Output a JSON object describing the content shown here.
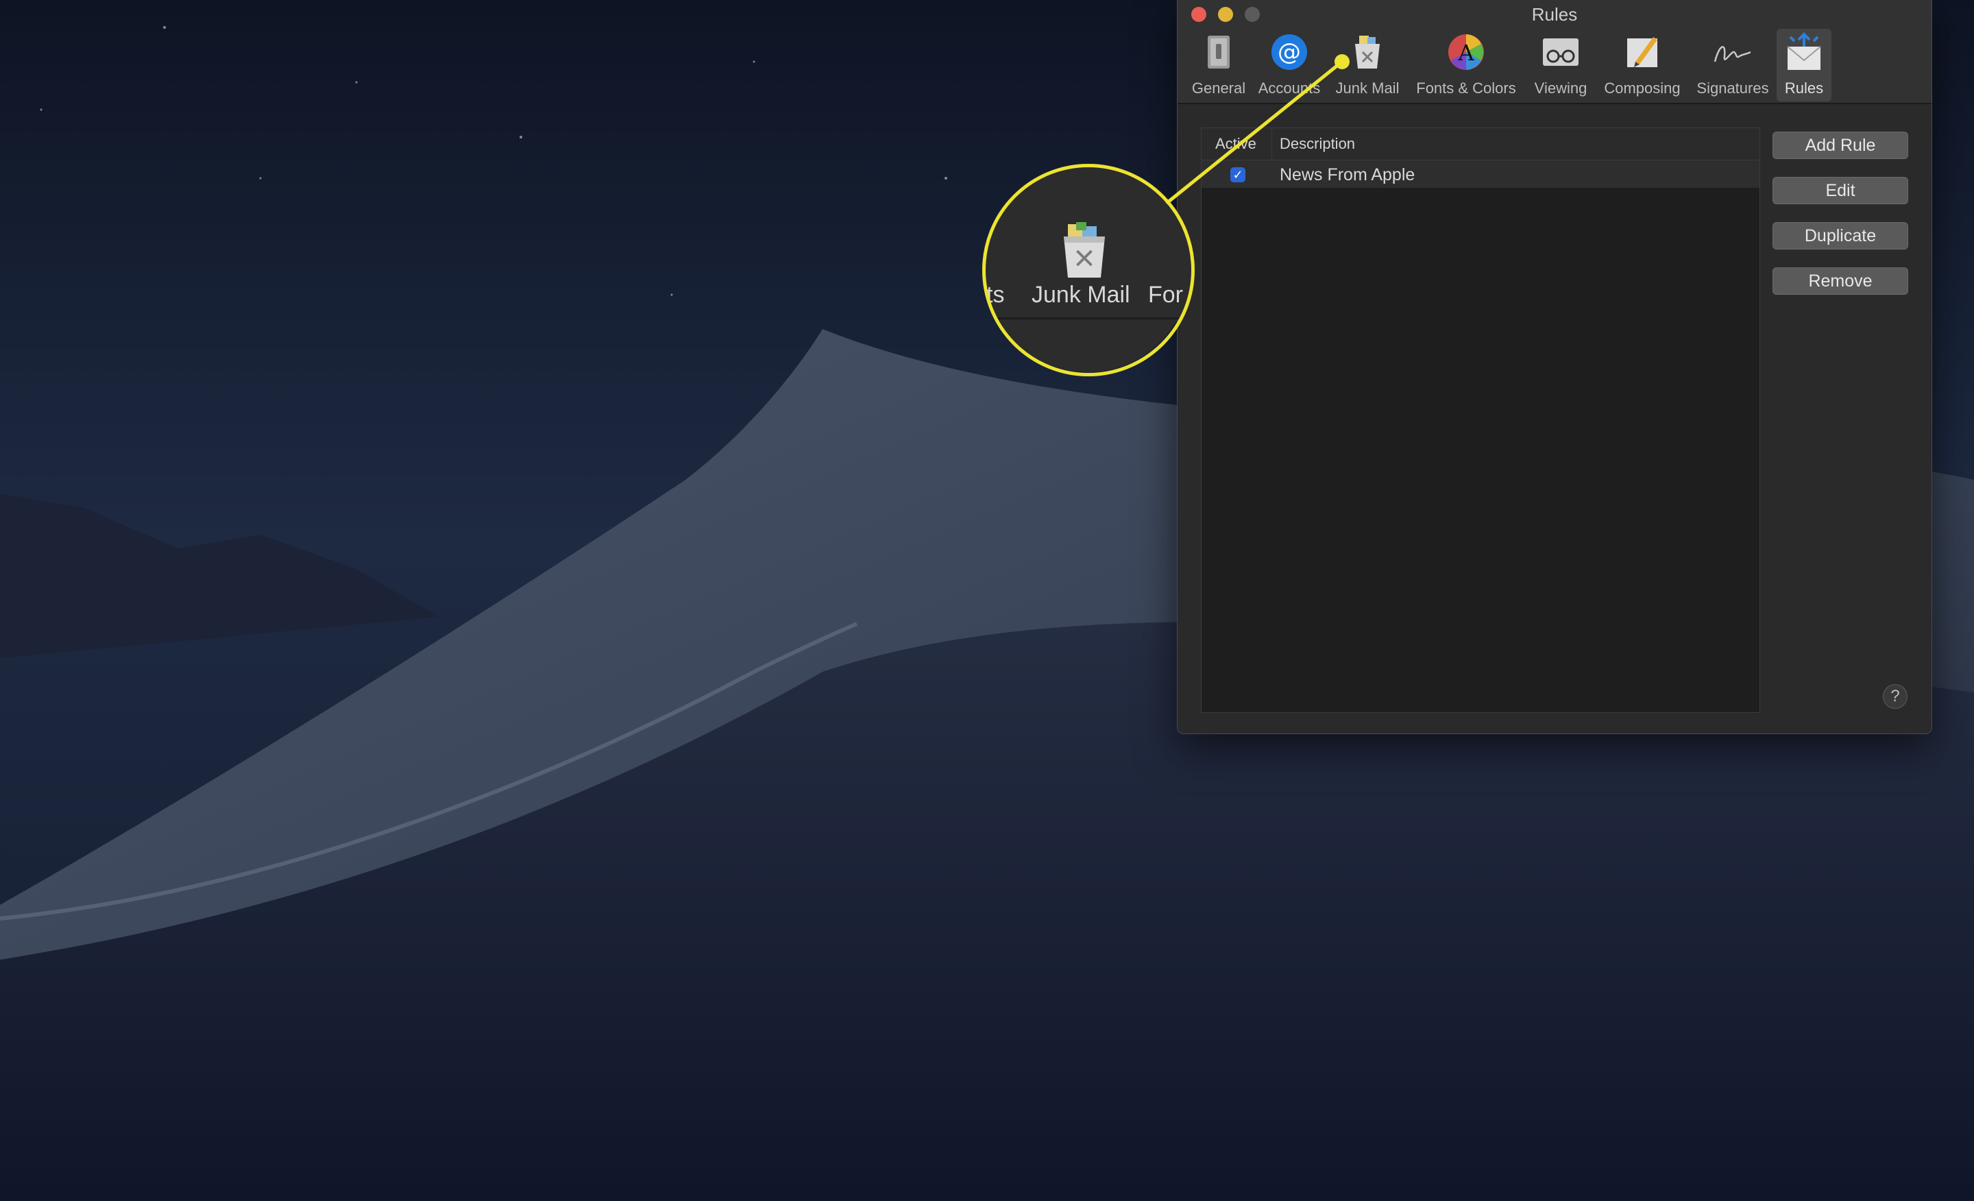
{
  "window": {
    "title": "Rules"
  },
  "toolbar": {
    "items": [
      {
        "label": "General",
        "icon": "general-switch-icon"
      },
      {
        "label": "Accounts",
        "icon": "at-sign-icon"
      },
      {
        "label": "Junk Mail",
        "icon": "junk-mail-trash-icon"
      },
      {
        "label": "Fonts & Colors",
        "icon": "fonts-colors-wheel-icon"
      },
      {
        "label": "Viewing",
        "icon": "glasses-icon"
      },
      {
        "label": "Composing",
        "icon": "pencil-paper-icon"
      },
      {
        "label": "Signatures",
        "icon": "signature-icon"
      },
      {
        "label": "Rules",
        "icon": "rules-envelope-icon",
        "selected": true
      }
    ]
  },
  "rules_table": {
    "columns": [
      "Active",
      "Description"
    ],
    "rows": [
      {
        "active": true,
        "description": "News From Apple"
      }
    ]
  },
  "buttons": {
    "add": "Add Rule",
    "edit": "Edit",
    "duplicate": "Duplicate",
    "remove": "Remove",
    "help": "?"
  },
  "magnifier": {
    "left_fragment": "ts",
    "center_label": "Junk Mail",
    "right_fragment": "For",
    "highlight_color": "#ece430"
  },
  "colors": {
    "close": "#ec5d55",
    "minimize": "#e1b539",
    "checkbox": "#2a66d8"
  }
}
